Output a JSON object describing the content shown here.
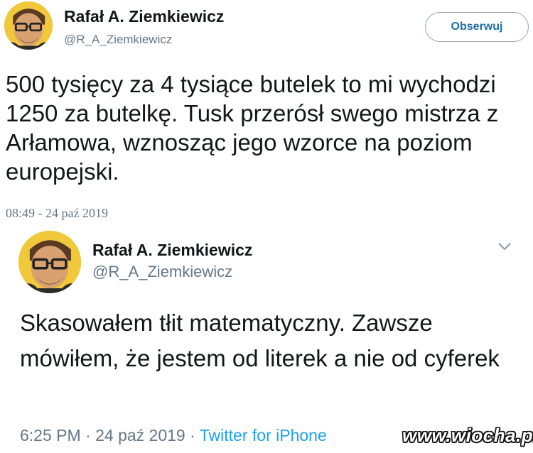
{
  "tweet_main": {
    "display_name": "Rafał A. Ziemkiewicz",
    "handle": "@R_A_Ziemkiewicz",
    "follow_label": "Obserwuj",
    "text": "500 tysięcy za 4 tysiące butelek to mi wychodzi 1250 za butelkę. Tusk przerósł swego mistrza z Arłamowa, wznosząc jego wzorce na poziom europejski.",
    "timestamp": "08:49 - 24 paź 2019"
  },
  "tweet_quoted": {
    "display_name": "Rafał A. Ziemkiewicz",
    "handle": "@R_A_Ziemkiewicz",
    "text": "Skasowałem tłit matematyczny. Zawsze mówiłem, że jestem od literek a nie od cyferek",
    "time": "6:25 PM",
    "separator": "·",
    "date": "24 paź 2019",
    "source": "Twitter for iPhone"
  },
  "watermark": "www.wiocha.pl",
  "colors": {
    "text": "#14171a",
    "secondary": "#657786",
    "link": "#1da1f2",
    "avatar_bg": "#f0c83a"
  },
  "icons": [
    "avatar",
    "chevron-down-icon"
  ]
}
